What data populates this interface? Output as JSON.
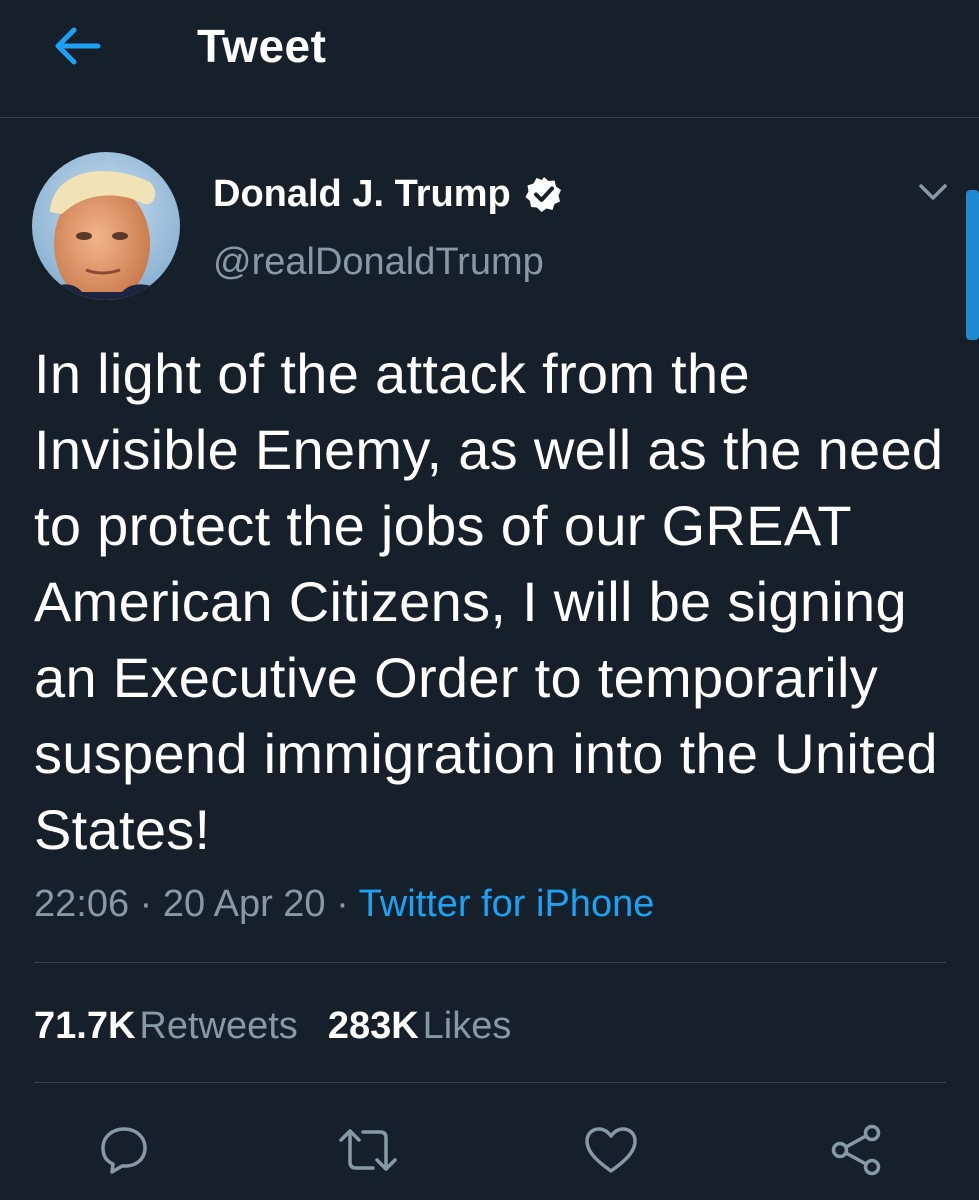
{
  "header": {
    "title": "Tweet",
    "back_icon": "arrow-left-icon"
  },
  "author": {
    "display_name": "Donald J. Trump",
    "handle": "@realDonaldTrump",
    "verified": true
  },
  "tweet": {
    "text": "In light of the attack from the Invisible Enemy, as well as the need to protect the jobs of our GREAT American Citizens, I will be signing an Executive Order to temporarily suspend immigration into the United States!",
    "time": "22:06",
    "date": "20 Apr 20",
    "separator": "·",
    "source": "Twitter for iPhone"
  },
  "stats": {
    "retweets_count": "71.7K",
    "retweets_label": "Retweets",
    "likes_count": "283K",
    "likes_label": "Likes"
  },
  "actions": [
    "reply-icon",
    "retweet-icon",
    "like-icon",
    "share-icon"
  ],
  "colors": {
    "background": "#15202b",
    "accent": "#1da1f2",
    "secondary_text": "#8899a6",
    "divider": "#38444d"
  }
}
